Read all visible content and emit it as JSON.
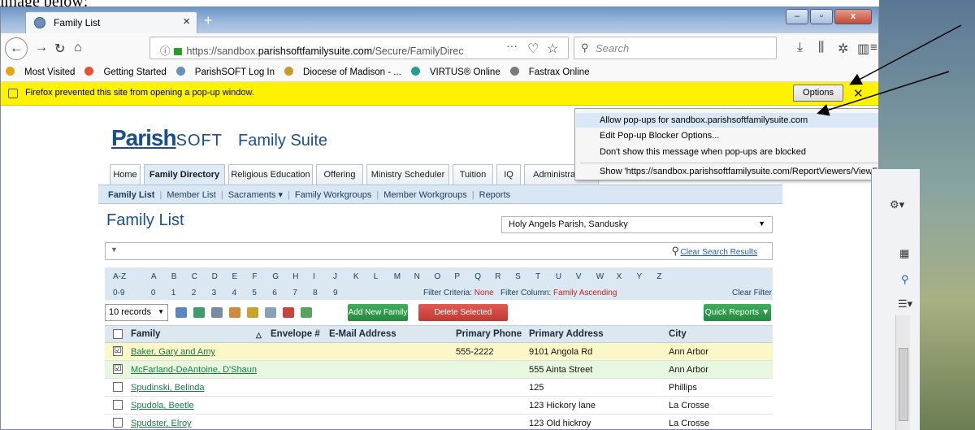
{
  "caption": "image below:",
  "browser": {
    "tab_title": "Family List",
    "tab_close": "×",
    "new_tab": "+",
    "win_min": "–",
    "win_max": "▫",
    "win_close": "x",
    "url_prefix": "https://sandbox.",
    "url_domain": "parishsoftfamilysuite.com",
    "url_path": "/Secure/FamilyDirec",
    "url_more": "···",
    "search_placeholder": "Search",
    "bookmarks": [
      "Most Visited",
      "Getting Started",
      "ParishSOFT Log In",
      "Diocese of Madison - ...",
      "VIRTUS® Online",
      "Fastrax Online"
    ],
    "bookmark_colors": [
      "#e8a317",
      "#e2543a",
      "#6a8fb8",
      "#c79a2e",
      "#2a9d8f",
      "#7a7a7a"
    ]
  },
  "notification": {
    "message": "Firefox prevented this site from opening a pop-up window.",
    "options_label": "Options",
    "close": "✕"
  },
  "popup_menu": {
    "items": [
      "Allow pop-ups for sandbox.parishsoftfamilysuite.com",
      "Edit Pop-up Blocker Options...",
      "Don't show this message when pop-ups are blocked",
      "Show 'https://sandbox.parishsoftfamilysuite.com/ReportViewers/ViewFamilyRepor..."
    ]
  },
  "app": {
    "logo_main": "Parish",
    "logo_sub": "SOFT",
    "suite": "Family Suite",
    "tabs": [
      "Home",
      "Family Directory",
      "Religious Education",
      "Offering",
      "Ministry Scheduler",
      "Tuition",
      "IQ",
      "Administration"
    ],
    "subnav": [
      "Family List",
      "Member List",
      "Sacraments ▾",
      "Family Workgroups",
      "Member Workgroups",
      "Reports"
    ],
    "page_title": "Family List",
    "parish": "Holy Angels Parish, Sandusky",
    "clear_search": "Clear Search Results",
    "alpha_row1": [
      "A-Z",
      "A",
      "B",
      "C",
      "D",
      "E",
      "F",
      "G",
      "H",
      "I",
      "J",
      "K",
      "L",
      "M",
      "N",
      "O",
      "P",
      "Q",
      "R",
      "S",
      "T",
      "U",
      "V",
      "W",
      "X",
      "Y",
      "Z"
    ],
    "alpha_row2": [
      "0-9",
      "0",
      "1",
      "2",
      "3",
      "4",
      "5",
      "6",
      "7",
      "8",
      "9"
    ],
    "filter_criteria_label": "Filter Criteria:",
    "filter_criteria_value": "None",
    "filter_column_label": "Filter Column:",
    "filter_column_value": "Family Ascending",
    "clear_filter": "Clear Filter",
    "records": "10 records",
    "add_family": "Add New Family",
    "delete_families": "Delete Selected Families",
    "quick_reports": "Quick Reports ▼",
    "columns": [
      "Family",
      "Envelope #",
      "E-Mail Address",
      "Primary Phone",
      "Primary Address",
      "City"
    ],
    "rows": [
      {
        "family": "Baker, Gary and Amy",
        "phone": "555-2222",
        "address": "9101 Angola Rd",
        "city": "Ann Arbor",
        "checked": "☑"
      },
      {
        "family": "McFarland-DeAntoine, D'Shaun",
        "phone": "",
        "address": "555 Ainta Street",
        "city": "Ann Arbor",
        "checked": "☑"
      },
      {
        "family": "Spudinski, Belinda",
        "phone": "",
        "address": "125",
        "city": "Phillips",
        "checked": ""
      },
      {
        "family": "Spudola, Beetle",
        "phone": "",
        "address": "123 Hickory lane",
        "city": "La Crosse",
        "checked": ""
      },
      {
        "family": "Spudster, Elroy",
        "phone": "",
        "address": "123 Old hickroy",
        "city": "La Crosse",
        "checked": ""
      }
    ]
  },
  "colors": {
    "highlight_row1": "#fbf7c8",
    "highlight_row2": "#e8f7e0"
  }
}
